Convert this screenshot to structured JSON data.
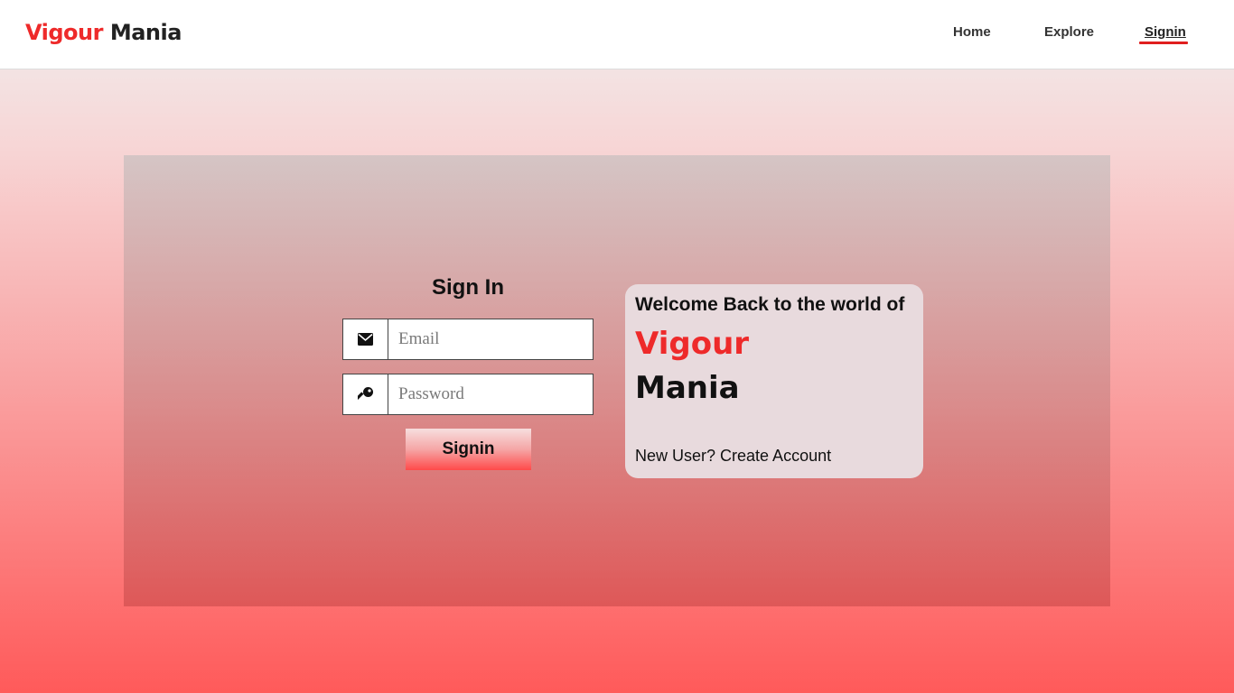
{
  "brand": {
    "part1": "Vigour",
    "part2": "Mania"
  },
  "nav": {
    "home": "Home",
    "explore": "Explore",
    "signin": "Signin",
    "active": "Signin"
  },
  "form": {
    "title": "Sign In",
    "email": {
      "placeholder": "Email",
      "value": "",
      "icon": "envelope-icon"
    },
    "password": {
      "placeholder": "Password",
      "value": "",
      "icon": "key-icon"
    },
    "submit_label": "Signin"
  },
  "welcome": {
    "heading": "Welcome Back to the world of",
    "brand_part1": "Vigour",
    "brand_part2": "Mania",
    "create_account": "New User? Create Account"
  },
  "colors": {
    "accent": "#ee2a2a",
    "nav_underline": "#e01f1f",
    "card_bg": "#e8dadd"
  }
}
